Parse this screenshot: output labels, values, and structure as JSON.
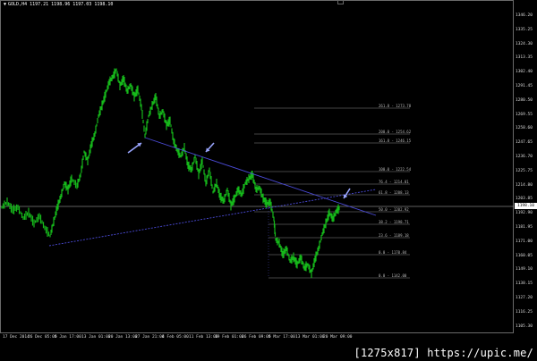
{
  "header": {
    "symbol": "GOLD,H4",
    "open": "1197.21",
    "high": "1198.96",
    "low": "1197.03",
    "close": "1198.10"
  },
  "current_price": "1198.10",
  "y_axis_ticks": [
    "1346.20",
    "1335.25",
    "1324.30",
    "1313.35",
    "1302.40",
    "1291.45",
    "1280.50",
    "1269.55",
    "1258.60",
    "1247.65",
    "1236.70",
    "1225.75",
    "1214.80",
    "1203.85",
    "1192.90",
    "1181.95",
    "1171.00",
    "1160.05",
    "1149.10",
    "1138.15",
    "1127.20",
    "1116.25",
    "1105.30"
  ],
  "x_axis_ticks": [
    "17 Dec 2014",
    "26 Dec 05:00",
    "5 Jan 17:00",
    "13 Jan 01:00",
    "20 Jan 13:00",
    "27 Jan 21:00",
    "4 Feb 05:00",
    "11 Feb 13:00",
    "19 Feb 01:00",
    "26 Feb 09:00",
    "5 Mar 17:00",
    "13 Mar 01:00",
    "20 Mar 09:00"
  ],
  "fibonacci_levels": [
    {
      "label": "261.8 - 1273.78"
    },
    {
      "label": "200.0 - 1254.62"
    },
    {
      "label": "161.8 - 1246.15"
    },
    {
      "label": "100.0 - 1222.54"
    },
    {
      "label": "76.4 - 1214.01"
    },
    {
      "label": "61.8 - 1208.13"
    },
    {
      "label": "50.0 - 1202.92"
    },
    {
      "label": "38.2 - 1198.71"
    },
    {
      "label": "23.6 - 1189.18"
    },
    {
      "label": "0.0 - 1170.84"
    },
    {
      "label": "0.0 - 1142.00"
    }
  ],
  "colors": {
    "candles": "#16b81b",
    "trendline": "#4b4bd8",
    "fib": "#8a8a8a",
    "arrows": "#9aa6ff",
    "price_line": "#bfbfbf"
  },
  "annotations": [
    "arrow-1",
    "arrow-2",
    "arrow-3"
  ],
  "watermark": "[1275x817] https://upic.me/"
}
